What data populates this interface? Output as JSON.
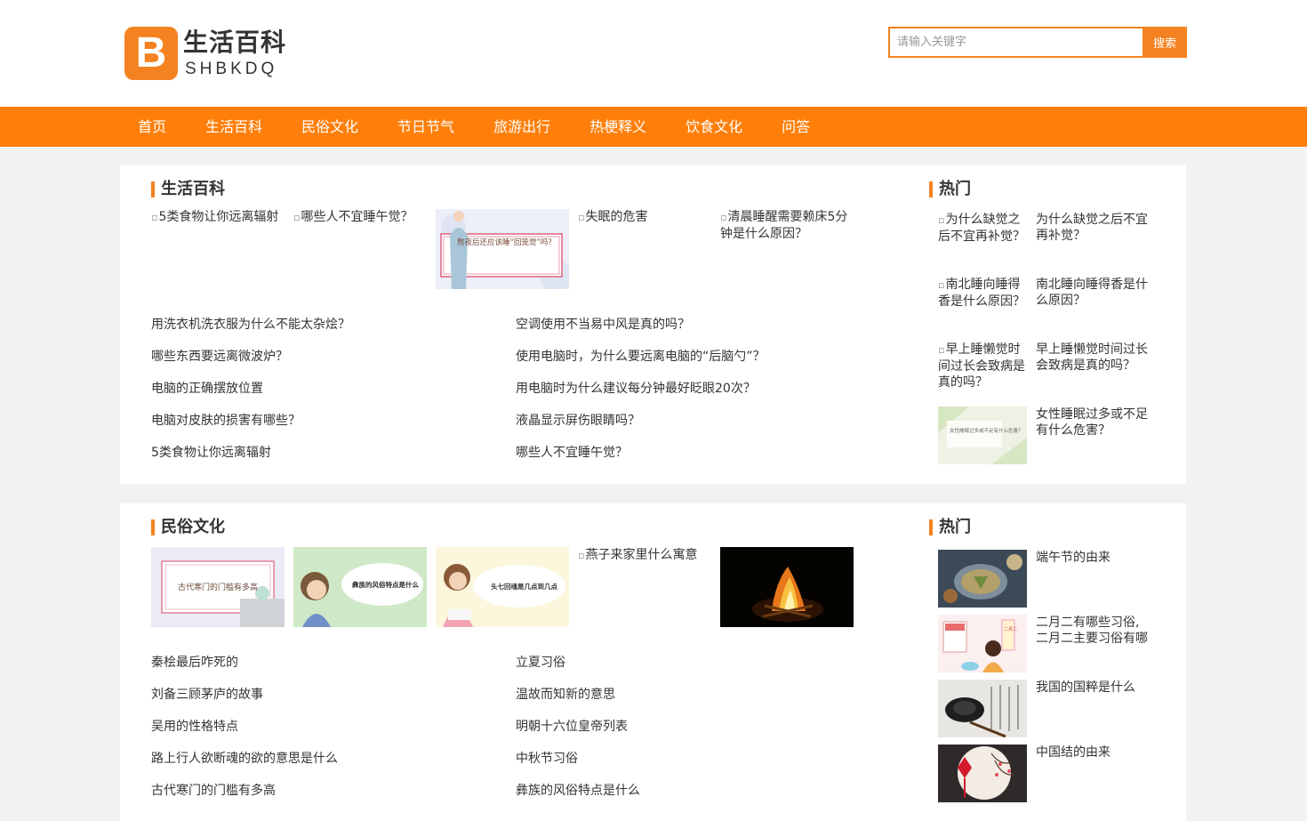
{
  "site": {
    "logo_letter": "B",
    "logo_cn": "生活百科",
    "logo_en": "SHBKDQ",
    "brand_color": "#f58220"
  },
  "search": {
    "placeholder": "请输入关键字",
    "button": "搜索"
  },
  "nav": [
    "首页",
    "生活百科",
    "民俗文化",
    "节日节气",
    "旅游出行",
    "热梗释义",
    "饮食文化",
    "问答"
  ],
  "section1": {
    "title": "生活百科",
    "thumbs": [
      {
        "alt": "5类食物让你远离辐射"
      },
      {
        "alt": "哪些人不宜睡午觉？"
      },
      {
        "caption": "熬夜后还应该睡“回笼觉”吗？"
      },
      {
        "alt": "失眠的危害"
      },
      {
        "alt": "清晨睡醒需要赖床5分钟是什么原因？"
      }
    ],
    "left_list": [
      "用洗衣机洗衣服为什么不能太杂烩？",
      "哪些东西要远离微波炉？",
      "电脑的正确摆放位置",
      "电脑对皮肤的损害有哪些？",
      "5类食物让你远离辐射"
    ],
    "right_list": [
      "空调使用不当易中风是真的吗？",
      "使用电脑时，为什么要远离电脑的“后脑勺”？",
      "用电脑时为什么建议每分钟最好眨眼20次？",
      "液晶显示屏伤眼睛吗？",
      "哪些人不宜睡午觉？"
    ],
    "hot_title": "热门",
    "hot": [
      {
        "alt": "为什么缺觉之后不宜再补觉？",
        "text": "为什么缺觉之后不宜再补觉？"
      },
      {
        "alt": "南北睡向睡得香是什么原因？",
        "text": "南北睡向睡得香是什么原因？"
      },
      {
        "alt": "早上睡懒觉时间过长会致病是真的吗？",
        "text": "早上睡懒觉时间过长会致病是真的吗？"
      },
      {
        "caption": "女性睡眠过多或不足有什么危害？",
        "text": "女性睡眠过多或不足有什么危害？"
      }
    ]
  },
  "section2": {
    "title": "民俗文化",
    "thumbs": [
      {
        "caption": "古代寒门的门槛有多高"
      },
      {
        "caption": "彝族的风俗特点是什么"
      },
      {
        "caption": "头七回魂是几点到几点"
      },
      {
        "alt": "燕子来家里什么寓意"
      },
      {
        "caption": ""
      }
    ],
    "left_list": [
      "秦桧最后咋死的",
      "刘备三顾茅庐的故事",
      "吴用的性格特点",
      "路上行人欲断魂的欲的意思是什么",
      "古代寒门的门槛有多高"
    ],
    "right_list": [
      "立夏习俗",
      "温故而知新的意思",
      "明朝十六位皇帝列表",
      "中秋节习俗",
      "彝族的风俗特点是什么"
    ],
    "hot_title": "热门",
    "hot": [
      {
        "text": "端午节的由来"
      },
      {
        "caption": "二月二",
        "text": "二月二有哪些习俗,二月二主要习俗有哪些"
      },
      {
        "text": "我国的国粹是什么"
      },
      {
        "text": "中国结的由来"
      }
    ]
  }
}
